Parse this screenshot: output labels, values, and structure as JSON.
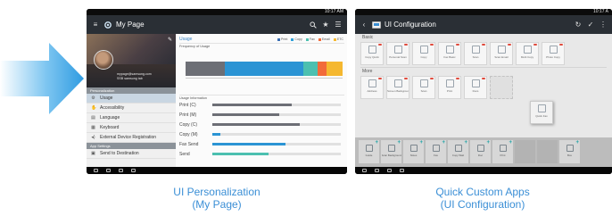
{
  "arrow": {
    "icon": "right-arrow-icon",
    "color": "#3da7e6"
  },
  "tablet_left": {
    "status": {
      "time": "10:17 AM"
    },
    "header": {
      "icon": "gear-icon",
      "title": "My Page",
      "actions": [
        "search-icon",
        "star-icon",
        "settings-list-icon"
      ]
    },
    "profile": {
      "icon": "avatar",
      "line1": "mypage@samsung.com",
      "line2": "SSB samsung tab",
      "edit_icon": "pencil-icon"
    },
    "personalization_header": "Personalization",
    "menu": [
      {
        "label": "Usage",
        "icon": "gear-icon",
        "active": true
      },
      {
        "label": "Accessibility",
        "icon": "accessibility-icon",
        "active": false
      },
      {
        "label": "Language",
        "icon": "language-icon",
        "active": false
      },
      {
        "label": "Keyboard",
        "icon": "keyboard-icon",
        "active": false
      },
      {
        "label": "External Device Registration",
        "icon": "external-device-icon",
        "active": false
      }
    ],
    "app_settings_header": "App Settings",
    "send_to_destination": {
      "label": "Send to Destination",
      "icon": "send-icon"
    },
    "usage_title": "Usage",
    "legend": [
      {
        "label": "Print",
        "color": "#3b6fb3"
      },
      {
        "label": "Copy",
        "color": "#2ea0d9"
      },
      {
        "label": "Fax",
        "color": "#4cc0b0"
      },
      {
        "label": "Email",
        "color": "#f26b3a"
      },
      {
        "label": "ETC",
        "color": "#f5b830"
      }
    ],
    "frequency_label": "Frequency of Usage",
    "frequency_segments": [
      {
        "color": "#6d6f76",
        "fraction": 0.25
      },
      {
        "color": "#2b94d4",
        "fraction": 0.5
      },
      {
        "color": "#4cc0b0",
        "fraction": 0.09
      },
      {
        "color": "#f26b3a",
        "fraction": 0.06
      },
      {
        "color": "#f5b830",
        "fraction": 0.1
      }
    ],
    "usage_info_label": "Usage Information",
    "usage_rows": [
      {
        "label": "Print (C)",
        "fraction": 0.62,
        "color": "#6d6f76"
      },
      {
        "label": "Print (M)",
        "fraction": 0.52,
        "color": "#6d6f76"
      },
      {
        "label": "Copy (C)",
        "fraction": 0.68,
        "color": "#6d6f76"
      },
      {
        "label": "Copy (M)",
        "fraction": 0.06,
        "color": "#2b94d4"
      },
      {
        "label": "Fax Send",
        "fraction": 0.57,
        "color": "#2b94d4"
      },
      {
        "label": "Send",
        "fraction": 0.44,
        "color": "#4cc0b0"
      }
    ]
  },
  "tablet_right": {
    "status": {
      "time": "10:17 A"
    },
    "header": {
      "icon": "folder-icon",
      "title": "UI Configuration",
      "back_icon": "back-icon",
      "actions": [
        "refresh-icon",
        "check-icon",
        "more-icon"
      ]
    },
    "basic_label": "Basic",
    "basic_apps": [
      {
        "label": "Copy Quick"
      },
      {
        "label": "Personal Scan"
      },
      {
        "label": "Copy"
      },
      {
        "label": "Fax Basic"
      },
      {
        "label": "Scan"
      },
      {
        "label": "Scan Email"
      },
      {
        "label": "Multi Copy"
      },
      {
        "label": "Photo Copy"
      }
    ],
    "more_label": "More",
    "more_apps": [
      {
        "label": "Address"
      },
      {
        "label": "Screen Background"
      },
      {
        "label": "Scan"
      },
      {
        "label": "Print"
      },
      {
        "label": "Docs"
      },
      {
        "label": "",
        "ghost": true
      }
    ],
    "floating_tile": {
      "label": "Quick Fax"
    },
    "tray_apps": [
      {
        "label": "Guide"
      },
      {
        "label": "Scan Background"
      },
      {
        "label": "Notes"
      },
      {
        "label": "Fax"
      },
      {
        "label": "Copy Wait"
      },
      {
        "label": "Doc"
      },
      {
        "label": "Print"
      },
      {
        "label": "",
        "empty": true
      },
      {
        "label": "",
        "empty": true
      },
      {
        "label": "Box"
      }
    ]
  },
  "captions": {
    "left_line1": "UI Personalization",
    "left_line2": "(My Page)",
    "right_line1": "Quick Custom Apps",
    "right_line2": "(UI Configuration)"
  }
}
